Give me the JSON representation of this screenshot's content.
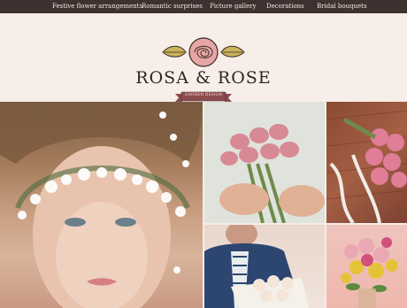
{
  "nav": {
    "items": [
      {
        "label": "Festive flower arrangements"
      },
      {
        "label": "Romantic surprises"
      },
      {
        "label": "Picture gallery"
      },
      {
        "label": "Decorations"
      },
      {
        "label": "Bridal bouquets"
      }
    ]
  },
  "brand": {
    "name": "ROSA & ROSE",
    "tagline": "GARDEN DESIGN"
  },
  "colors": {
    "nav_bg": "#3d3230",
    "header_bg": "#f7eee9",
    "accent_pink": "#e6a6a6",
    "accent_olive": "#c9b25a",
    "ribbon": "#8e4b4e"
  }
}
